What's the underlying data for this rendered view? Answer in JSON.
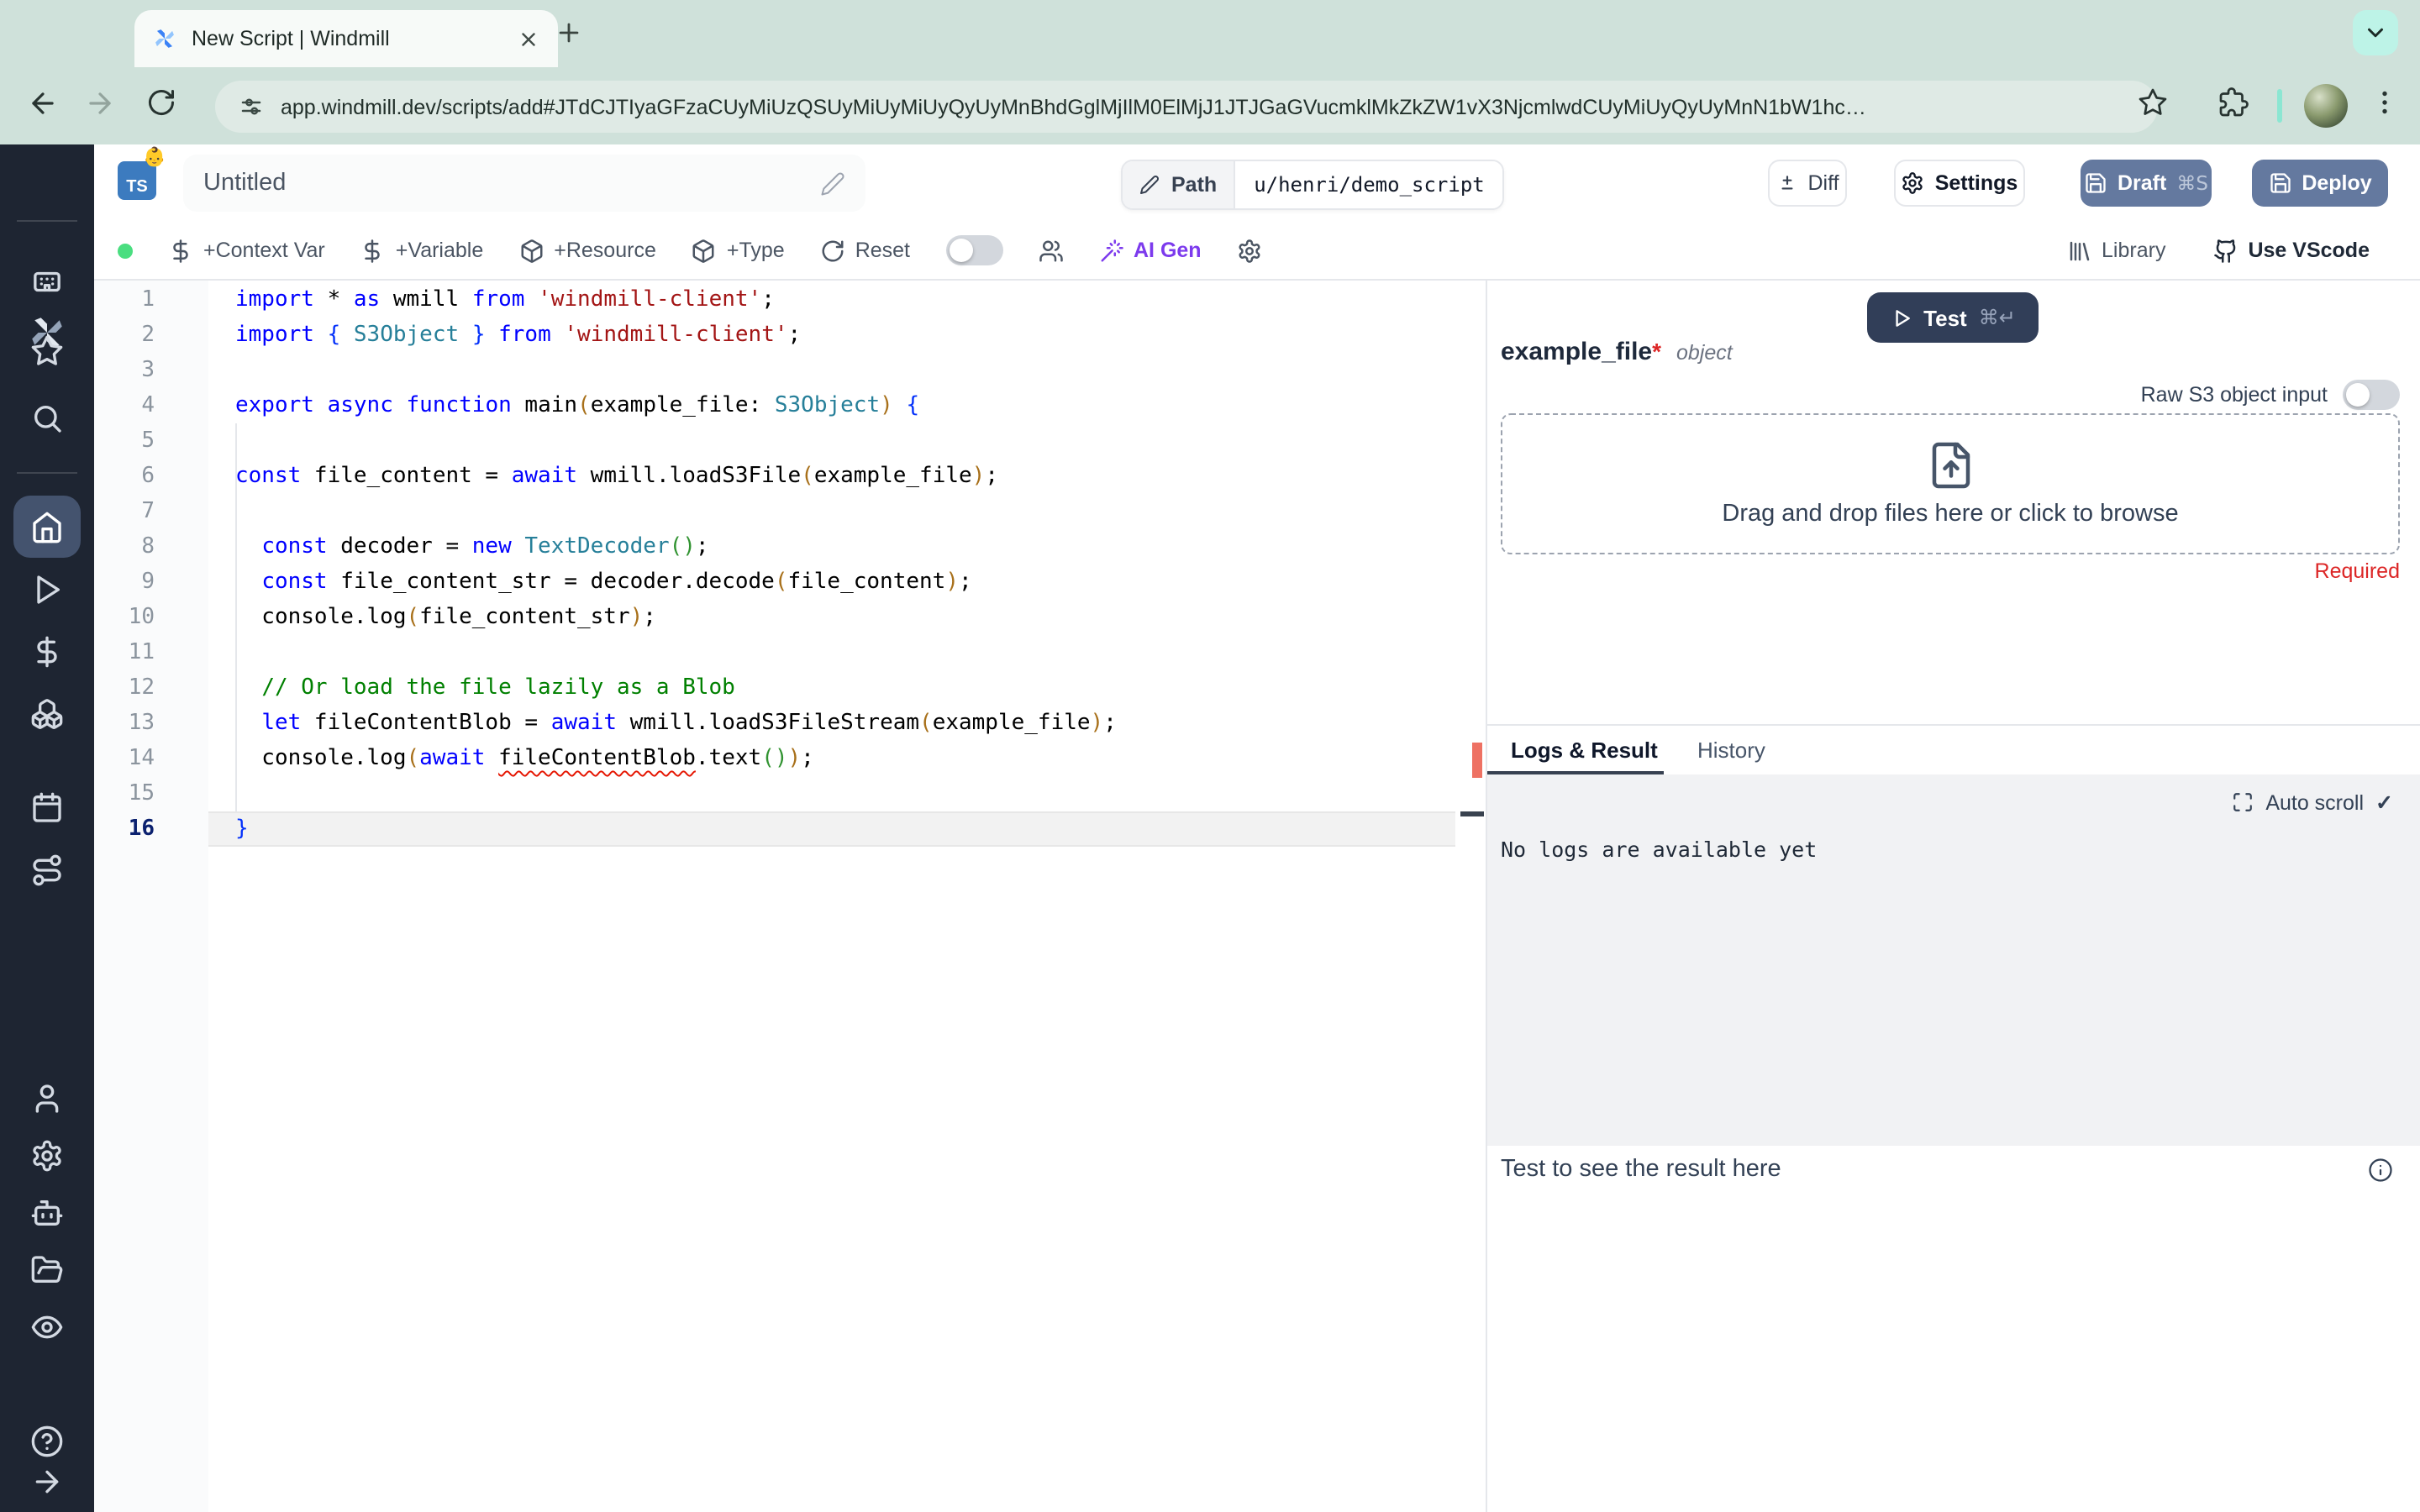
{
  "browser": {
    "tab_title": "New Script | Windmill",
    "url": "app.windmill.dev/scripts/add#JTdCJTIyaGFzaCUyMiUzQSUyMiUyMiUyQyUyMnBhdGglMjIlM0ElMjJ1JTJGaGVucmklMkZkZW1vX3NjcmlwdCUyMiUyQyUyMnN1bW1hc…"
  },
  "header": {
    "lang_badge": "TS",
    "emoji": "👶",
    "title": "Untitled",
    "path_label": "Path",
    "path_value": "u/henri/demo_script",
    "diff_label": "Diff",
    "settings_label": "Settings",
    "draft_label": "Draft",
    "draft_shortcut": "⌘S",
    "deploy_label": "Deploy"
  },
  "toolbar": {
    "left": [
      {
        "type": "dot",
        "name": "status-dot",
        "interactable": false
      },
      {
        "type": "btn",
        "icon": "dollar",
        "label": "+Context Var",
        "name": "add-context-var-button"
      },
      {
        "type": "btn",
        "icon": "dollar",
        "label": "+Variable",
        "name": "add-variable-button"
      },
      {
        "type": "btn",
        "icon": "package",
        "label": "+Resource",
        "name": "add-resource-button"
      },
      {
        "type": "btn",
        "icon": "package",
        "label": "+Type",
        "name": "add-type-button"
      },
      {
        "type": "btn",
        "icon": "rotate",
        "label": "Reset",
        "name": "reset-button"
      },
      {
        "type": "toggle",
        "name": "multiplayer-toggle"
      },
      {
        "type": "iconbtn",
        "icon": "users",
        "name": "multiplayer-users-button"
      },
      {
        "type": "btn",
        "icon": "wand",
        "label": "AI Gen",
        "name": "ai-gen-button",
        "accent": true
      },
      {
        "type": "iconbtn",
        "icon": "gear",
        "name": "editor-settings-button"
      }
    ],
    "right": [
      {
        "type": "btn",
        "icon": "library",
        "label": "Library",
        "name": "library-button"
      },
      {
        "type": "btn",
        "icon": "github",
        "label": "Use VScode",
        "name": "use-vscode-button",
        "strong": true
      }
    ]
  },
  "sidebar": {
    "groups": [
      {
        "cls": "g2",
        "items": [
          {
            "icon": "workspace",
            "name": "sidebar-item-workspace"
          },
          {
            "icon": "star",
            "name": "sidebar-item-favorites"
          },
          {
            "icon": "search",
            "name": "sidebar-item-search"
          }
        ]
      },
      {
        "cls": "g3",
        "items": [
          {
            "icon": "home",
            "name": "sidebar-item-home",
            "active": true
          },
          {
            "icon": "play",
            "name": "sidebar-item-runs"
          },
          {
            "icon": "dollar",
            "name": "sidebar-item-variables"
          },
          {
            "icon": "cubes",
            "name": "sidebar-item-resources"
          }
        ]
      },
      {
        "cls": "g4",
        "items": [
          {
            "icon": "calendar",
            "name": "sidebar-item-schedules"
          },
          {
            "icon": "route",
            "name": "sidebar-item-routes"
          }
        ]
      },
      {
        "cls": "g5",
        "items": [
          {
            "icon": "user",
            "name": "sidebar-item-users"
          },
          {
            "icon": "gear",
            "name": "sidebar-item-settings"
          },
          {
            "icon": "robot",
            "name": "sidebar-item-workers"
          },
          {
            "icon": "folder",
            "name": "sidebar-item-folders"
          },
          {
            "icon": "eye",
            "name": "sidebar-item-audit-logs"
          }
        ]
      },
      {
        "cls": "g6",
        "items": [
          {
            "icon": "help",
            "name": "sidebar-item-help"
          },
          {
            "icon": "arrow-right",
            "name": "sidebar-expand-button"
          }
        ]
      }
    ]
  },
  "editor": {
    "colors": {
      "kw": "#0000ff",
      "typ": "#267f99",
      "str": "#a31515",
      "com": "#008000",
      "pln": "#000000",
      "b1": "#0431fa",
      "b2": "#a8701a",
      "b3": "#319331",
      "err": "#000000"
    },
    "lines": [
      {
        "n": 1,
        "t": [
          [
            "import",
            "kw"
          ],
          [
            " ",
            "pln"
          ],
          [
            "*",
            "pln"
          ],
          [
            " ",
            "pln"
          ],
          [
            "as",
            "kw"
          ],
          [
            " wmill ",
            "pln"
          ],
          [
            "from",
            "kw"
          ],
          [
            " ",
            "pln"
          ],
          [
            "'windmill-client'",
            "str"
          ],
          [
            ";",
            "pln"
          ]
        ]
      },
      {
        "n": 2,
        "t": [
          [
            "import",
            "kw"
          ],
          [
            " ",
            "pln"
          ],
          [
            "{",
            "b1"
          ],
          [
            " ",
            "pln"
          ],
          [
            "S3Object",
            "typ"
          ],
          [
            " ",
            "pln"
          ],
          [
            "}",
            "b1"
          ],
          [
            " ",
            "pln"
          ],
          [
            "from",
            "kw"
          ],
          [
            " ",
            "pln"
          ],
          [
            "'windmill-client'",
            "str"
          ],
          [
            ";",
            "pln"
          ]
        ]
      },
      {
        "n": 3,
        "t": []
      },
      {
        "n": 4,
        "t": [
          [
            "export",
            "kw"
          ],
          [
            " ",
            "pln"
          ],
          [
            "async",
            "kw"
          ],
          [
            " ",
            "pln"
          ],
          [
            "function",
            "kw"
          ],
          [
            " main",
            "pln"
          ],
          [
            "(",
            "b2"
          ],
          [
            "example_file",
            "pln"
          ],
          [
            ": ",
            "pln"
          ],
          [
            "S3Object",
            "typ"
          ],
          [
            ")",
            "b2"
          ],
          [
            " ",
            "pln"
          ],
          [
            "{",
            "b1"
          ]
        ]
      },
      {
        "n": 5,
        "t": []
      },
      {
        "n": 6,
        "t": [
          [
            "const",
            "kw"
          ],
          [
            " file_content = ",
            "pln"
          ],
          [
            "await",
            "kw"
          ],
          [
            " wmill.loadS3File",
            "pln"
          ],
          [
            "(",
            "b2"
          ],
          [
            "example_file",
            "pln"
          ],
          [
            ")",
            "b2"
          ],
          [
            ";",
            "pln"
          ]
        ]
      },
      {
        "n": 7,
        "t": []
      },
      {
        "n": 8,
        "t": [
          [
            "  ",
            "pln"
          ],
          [
            "const",
            "kw"
          ],
          [
            " decoder = ",
            "pln"
          ],
          [
            "new",
            "kw"
          ],
          [
            " ",
            "pln"
          ],
          [
            "TextDecoder",
            "typ"
          ],
          [
            "(",
            "b3"
          ],
          [
            ")",
            "b3"
          ],
          [
            ";",
            "pln"
          ]
        ]
      },
      {
        "n": 9,
        "t": [
          [
            "  ",
            "pln"
          ],
          [
            "const",
            "kw"
          ],
          [
            " file_content_str = decoder.decode",
            "pln"
          ],
          [
            "(",
            "b2"
          ],
          [
            "file_content",
            "pln"
          ],
          [
            ")",
            "b2"
          ],
          [
            ";",
            "pln"
          ]
        ]
      },
      {
        "n": 10,
        "t": [
          [
            "  console.log",
            "pln"
          ],
          [
            "(",
            "b2"
          ],
          [
            "file_content_str",
            "pln"
          ],
          [
            ")",
            "b2"
          ],
          [
            ";",
            "pln"
          ]
        ]
      },
      {
        "n": 11,
        "t": []
      },
      {
        "n": 12,
        "t": [
          [
            "  ",
            "pln"
          ],
          [
            "// Or load the file lazily as a Blob",
            "com"
          ]
        ]
      },
      {
        "n": 13,
        "t": [
          [
            "  ",
            "pln"
          ],
          [
            "let",
            "kw"
          ],
          [
            " fileContentBlob = ",
            "pln"
          ],
          [
            "await",
            "kw"
          ],
          [
            " wmill.loadS3FileStream",
            "pln"
          ],
          [
            "(",
            "b2"
          ],
          [
            "example_file",
            "pln"
          ],
          [
            ")",
            "b2"
          ],
          [
            ";",
            "pln"
          ]
        ]
      },
      {
        "n": 14,
        "t": [
          [
            "  console.log",
            "pln"
          ],
          [
            "(",
            "b2"
          ],
          [
            "await",
            "kw"
          ],
          [
            " ",
            "pln"
          ],
          [
            "fileContentBlob",
            "err"
          ],
          [
            ".text",
            "pln"
          ],
          [
            "(",
            "b3"
          ],
          [
            ")",
            "b3"
          ],
          [
            ")",
            "b2"
          ],
          [
            ";",
            "pln"
          ]
        ]
      },
      {
        "n": 15,
        "t": []
      },
      {
        "n": 16,
        "t": [
          [
            "}",
            "b1"
          ]
        ],
        "active": true
      }
    ]
  },
  "run_panel": {
    "test_label": "Test",
    "test_shortcut": "⌘↵",
    "arg_name": "example_file",
    "required_star": "*",
    "arg_type": "object",
    "raw_s3_label": "Raw S3 object input",
    "dropzone_text": "Drag and drop files here or click to browse",
    "required_label": "Required",
    "tab_logs": "Logs & Result",
    "tab_history": "History",
    "auto_scroll_label": "Auto scroll",
    "auto_scroll_check": "✓",
    "no_logs_text": "No logs are available yet",
    "result_placeholder": "Test to see the result here"
  },
  "colors": {
    "chrome_bg": "#cfe1da",
    "chrome_accent_button": "#bdf3e7",
    "ts_badge_blue": "#3c7bbf",
    "primary_button_slate": "#64799f",
    "test_button_navy": "#313e58",
    "ai_gen_purple": "#7c3aed",
    "status_green": "#4ade80",
    "required_red": "#dc2626",
    "error_marker": "#ee7163",
    "sidebar_bg": "#1e2532",
    "sidebar_active": "#44536e"
  }
}
